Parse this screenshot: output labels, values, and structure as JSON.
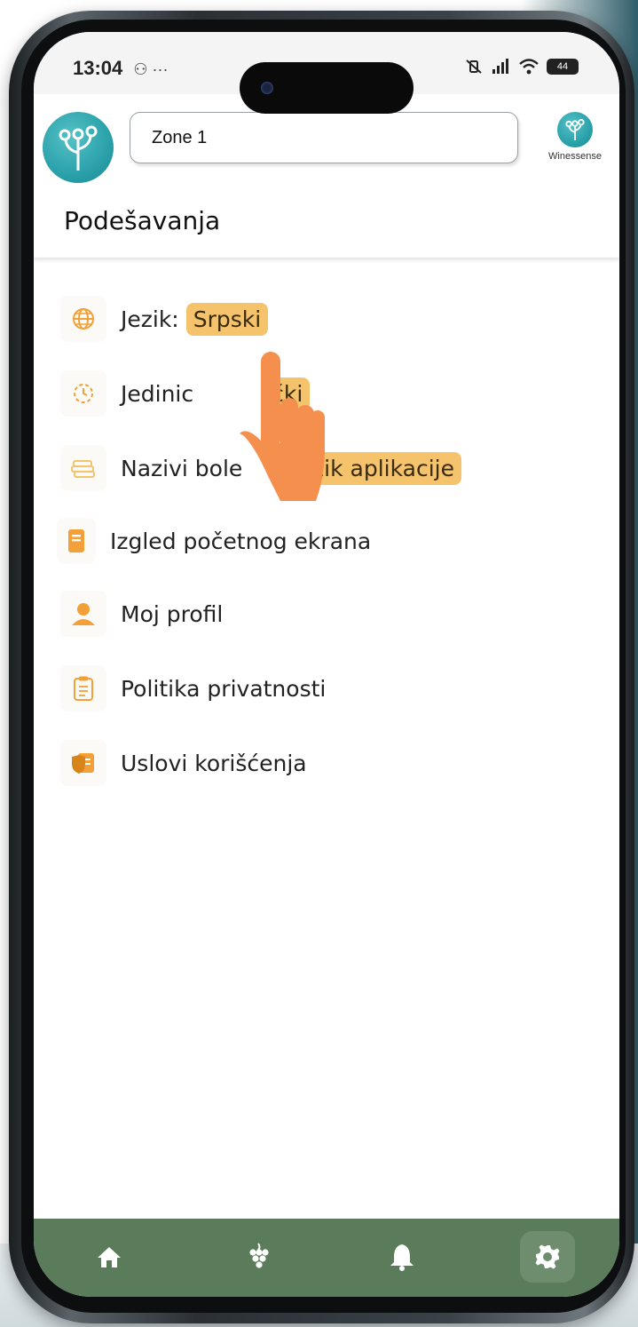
{
  "status": {
    "time": "13:04",
    "extra": "⚇ ···",
    "battery": "44"
  },
  "header": {
    "zone_value": "Zone 1",
    "brand_label": "Winessense"
  },
  "page": {
    "title": "Podešavanja"
  },
  "settings": {
    "language": {
      "label": "Jezik:",
      "value": "Srpski"
    },
    "units": {
      "label": "Jedinic",
      "value": "čki"
    },
    "disease_names": {
      "label": "Nazivi bole",
      "value": "Jezik aplikacije"
    },
    "home_layout": {
      "label": "Izgled početnog ekrana"
    },
    "profile": {
      "label": "Moj profil"
    },
    "privacy": {
      "label": "Politika privatnosti"
    },
    "terms": {
      "label": "Uslovi korišćenja"
    }
  },
  "colors": {
    "accent_chip": "#f5c36b",
    "navbar": "#5b7c5b",
    "icon_orange": "#f2a037",
    "pointer_hand": "#f48f4d",
    "logo_teal": "#2aa1aa"
  },
  "nav": {
    "items": [
      "home-icon",
      "grapes-icon",
      "bell-icon",
      "gear-icon"
    ],
    "active": "gear-icon"
  }
}
